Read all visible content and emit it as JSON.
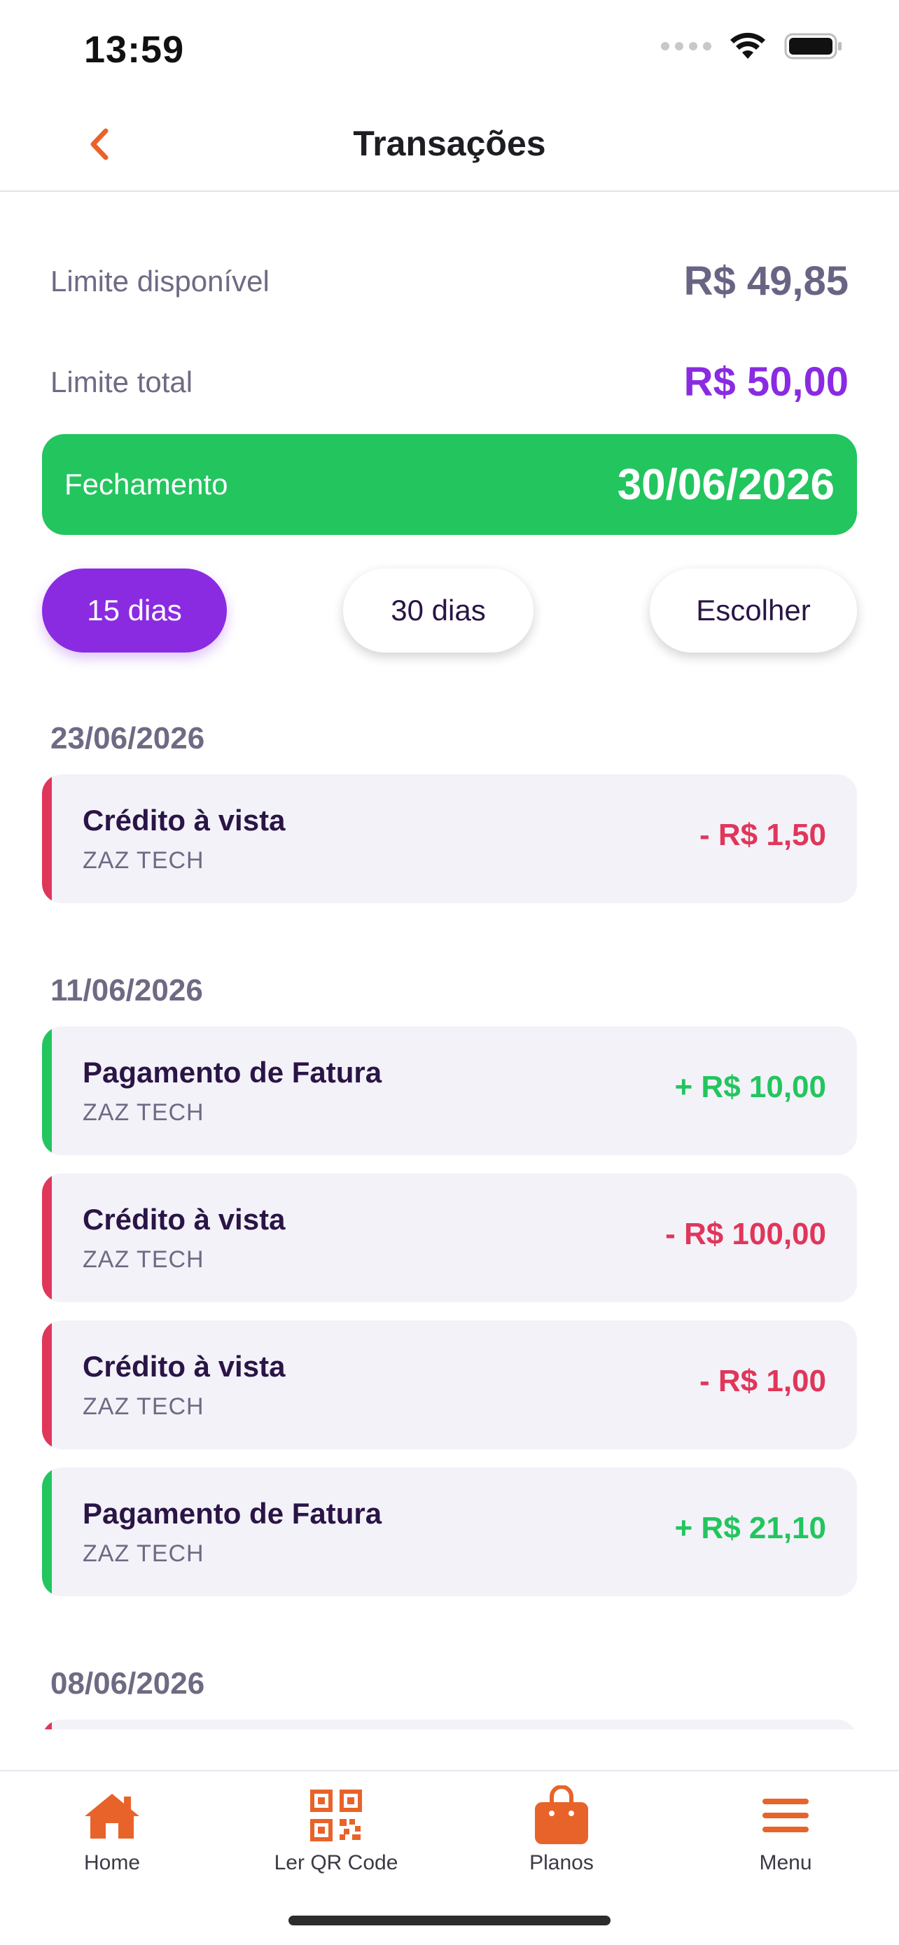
{
  "status_bar": {
    "time": "13:59"
  },
  "header": {
    "title": "Transações"
  },
  "limits": {
    "available_label": "Limite disponível",
    "available_value": "R$ 49,85",
    "total_label": "Limite total",
    "total_value": "R$ 50,00"
  },
  "closing": {
    "label": "Fechamento",
    "value": "30/06/2026"
  },
  "filters": {
    "days15": "15 dias",
    "days30": "30 dias",
    "choose": "Escolher",
    "selected": "15 dias"
  },
  "transactions": {
    "groups": [
      {
        "date": "23/06/2026",
        "items": [
          {
            "title": "Crédito à vista",
            "merchant": "ZAZ TECH",
            "amount": "- R$ 1,50",
            "kind": "debit"
          }
        ]
      },
      {
        "date": "11/06/2026",
        "items": [
          {
            "title": "Pagamento de Fatura",
            "merchant": "ZAZ TECH",
            "amount": "+ R$ 10,00",
            "kind": "credit"
          },
          {
            "title": "Crédito à vista",
            "merchant": "ZAZ TECH",
            "amount": "- R$ 100,00",
            "kind": "debit"
          },
          {
            "title": "Crédito à vista",
            "merchant": "ZAZ TECH",
            "amount": "- R$ 1,00",
            "kind": "debit"
          },
          {
            "title": "Pagamento de Fatura",
            "merchant": "ZAZ TECH",
            "amount": "+ R$ 21,10",
            "kind": "credit"
          }
        ]
      },
      {
        "date": "08/06/2026",
        "items": []
      }
    ]
  },
  "tabbar": {
    "home": "Home",
    "qr": "Ler QR Code",
    "plans": "Planos",
    "menu": "Menu"
  },
  "colors": {
    "accent_orange": "#e8632a",
    "primary_purple": "#8a2be2",
    "success_green": "#23c55e",
    "debit_red": "#e0365a"
  },
  "icons": {
    "back": "chevron-left-icon",
    "signal": "cellular-signal-icon",
    "wifi": "wifi-icon",
    "battery": "battery-icon",
    "home": "house-icon",
    "qr": "qr-code-icon",
    "plans": "shopping-bag-icon",
    "menu": "hamburger-menu-icon"
  }
}
